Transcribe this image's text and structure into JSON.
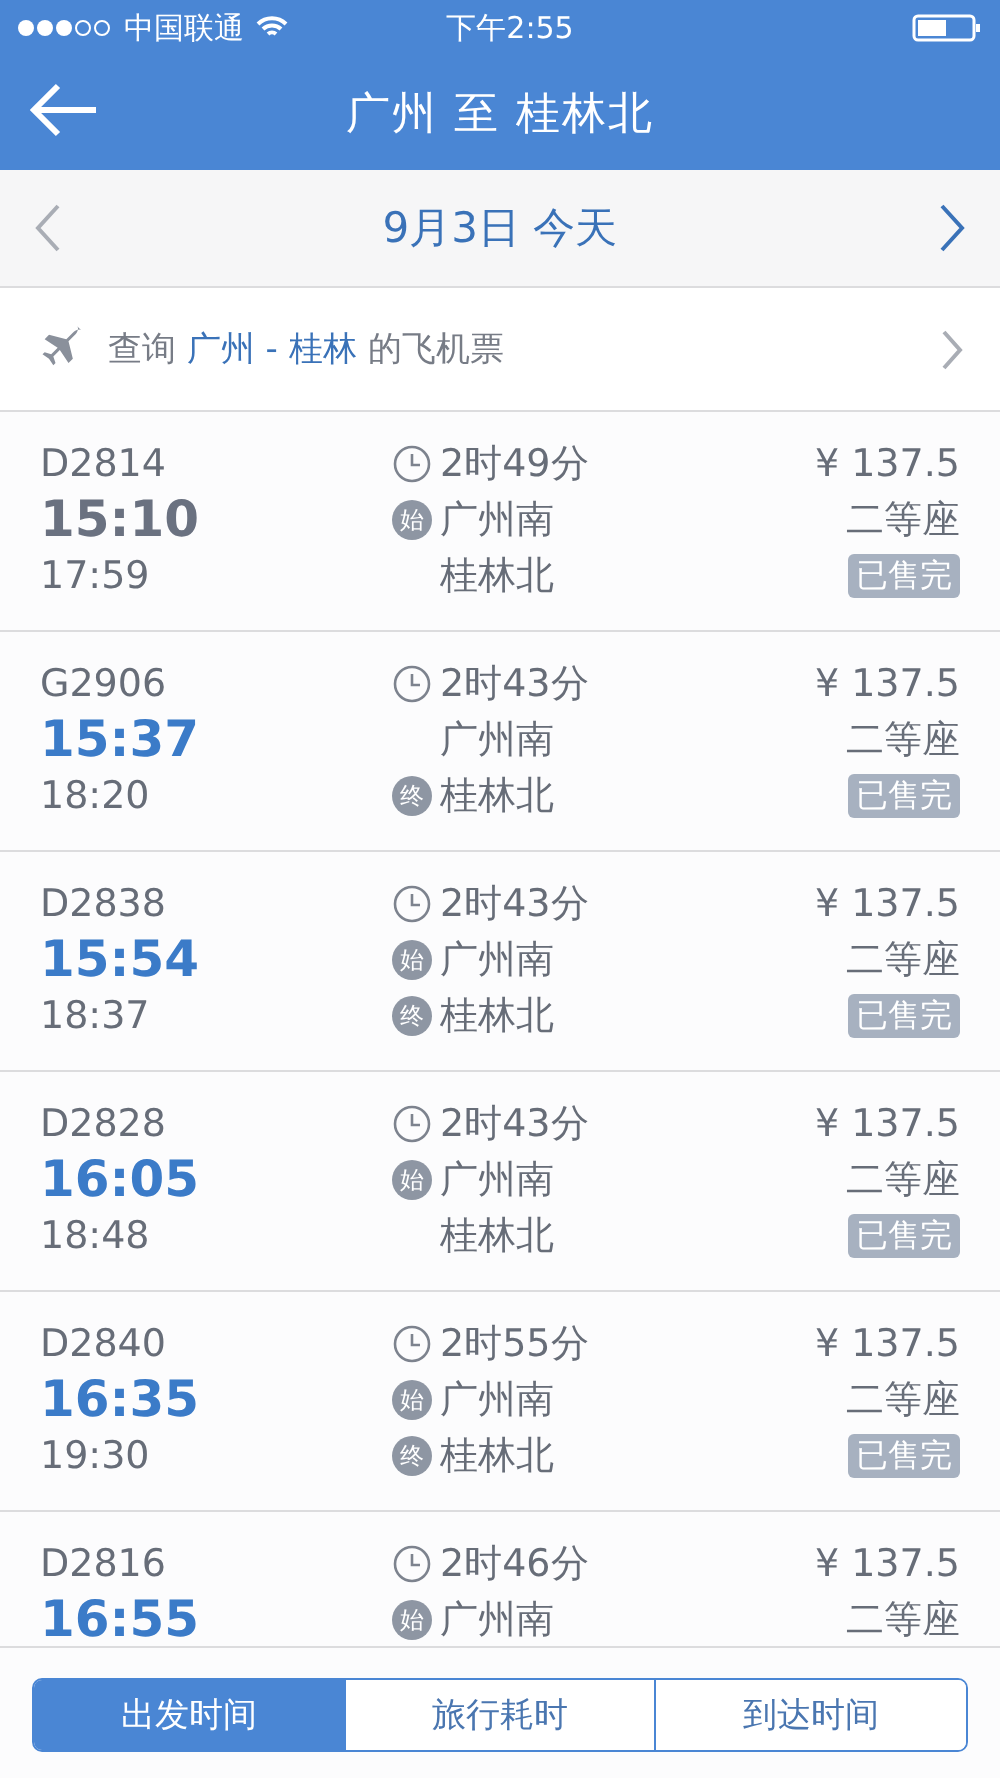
{
  "status_bar": {
    "carrier": "中国联通",
    "time": "下午2:55"
  },
  "nav": {
    "title": "广州 至 桂林北"
  },
  "date_bar": {
    "date": "9月3日 今天"
  },
  "flight_link": {
    "text_before": "查询 ",
    "route": "广州 - 桂林",
    "text_after": " 的飞机票"
  },
  "trains": [
    {
      "number": "D2814",
      "depart_time": "15:10",
      "departed": true,
      "arrive_time": "17:59",
      "duration": "2时49分",
      "from": {
        "badge": "始",
        "station": "广州南"
      },
      "to": {
        "station": "桂林北"
      },
      "price": "¥ 137.5",
      "seat": "二等座",
      "status": "已售完"
    },
    {
      "number": "G2906",
      "depart_time": "15:37",
      "departed": false,
      "arrive_time": "18:20",
      "duration": "2时43分",
      "from": {
        "station": "广州南"
      },
      "to": {
        "badge": "终",
        "station": "桂林北"
      },
      "price": "¥ 137.5",
      "seat": "二等座",
      "status": "已售完"
    },
    {
      "number": "D2838",
      "depart_time": "15:54",
      "departed": false,
      "arrive_time": "18:37",
      "duration": "2时43分",
      "from": {
        "badge": "始",
        "station": "广州南"
      },
      "to": {
        "badge": "终",
        "station": "桂林北"
      },
      "price": "¥ 137.5",
      "seat": "二等座",
      "status": "已售完"
    },
    {
      "number": "D2828",
      "depart_time": "16:05",
      "departed": false,
      "arrive_time": "18:48",
      "duration": "2时43分",
      "from": {
        "badge": "始",
        "station": "广州南"
      },
      "to": {
        "station": "桂林北"
      },
      "price": "¥ 137.5",
      "seat": "二等座",
      "status": "已售完"
    },
    {
      "number": "D2840",
      "depart_time": "16:35",
      "departed": false,
      "arrive_time": "19:30",
      "duration": "2时55分",
      "from": {
        "badge": "始",
        "station": "广州南"
      },
      "to": {
        "badge": "终",
        "station": "桂林北"
      },
      "price": "¥ 137.5",
      "seat": "二等座",
      "status": "已售完"
    },
    {
      "number": "D2816",
      "depart_time": "16:55",
      "departed": false,
      "duration": "2时46分",
      "from": {
        "badge": "始",
        "station": "广州南"
      },
      "price": "¥ 137.5",
      "seat": "二等座"
    }
  ],
  "sort_tabs": [
    {
      "label": "出发时间",
      "selected": true
    },
    {
      "label": "旅行耗时",
      "selected": false
    },
    {
      "label": "到达时间",
      "selected": false
    }
  ]
}
